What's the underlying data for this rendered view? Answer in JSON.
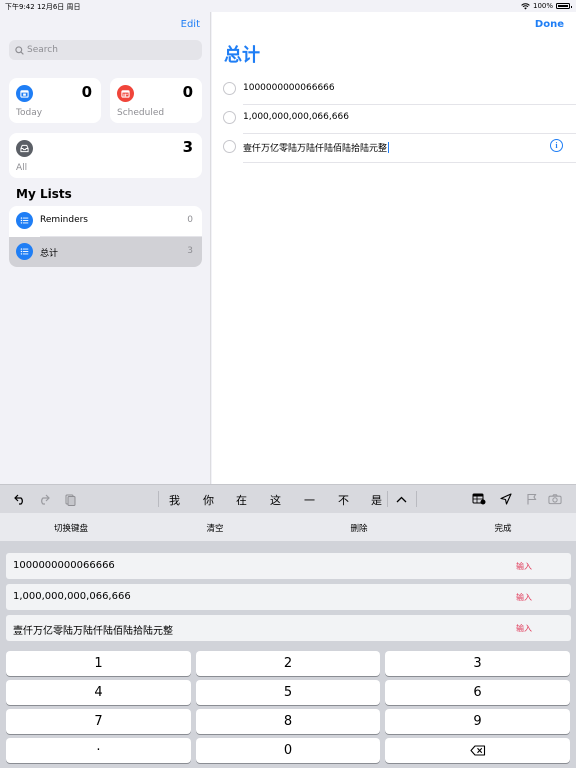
{
  "status_bar": {
    "time_date": "下午9:42  12月6日 周日",
    "battery": "100%"
  },
  "sidebar": {
    "edit_label": "Edit",
    "search_placeholder": "Search",
    "smart_lists": [
      {
        "label": "Today",
        "count": "0",
        "icon": "calendar-today-icon",
        "color": "#1f7ef5"
      },
      {
        "label": "Scheduled",
        "count": "0",
        "icon": "calendar-icon",
        "color": "#f0453a"
      },
      {
        "label": "All",
        "count": "3",
        "icon": "tray-icon",
        "color": "#5b5f66"
      }
    ],
    "my_lists_title": "My Lists",
    "lists": [
      {
        "name": "Reminders",
        "count": "0",
        "icon": "list-icon"
      },
      {
        "name": "总计",
        "count": "3",
        "icon": "list-icon",
        "selected": true
      }
    ]
  },
  "detail": {
    "done_label": "Done",
    "title": "总计",
    "accent": "#1f7ef5",
    "reminders": [
      {
        "text": "1000000000066666"
      },
      {
        "text": "1,000,000,000,066,666"
      },
      {
        "text": "壹仟万亿零陆万陆仟陆佰陆拾陆元整",
        "editing": true
      }
    ]
  },
  "shortcut_bar": {
    "candidates": [
      "我",
      "你",
      "在",
      "这",
      "一",
      "不",
      "是"
    ],
    "icons": [
      "undo-icon",
      "redo-icon",
      "paste-icon",
      "chevron-up-icon",
      "table-icon",
      "location-icon",
      "flag-icon",
      "camera-icon"
    ]
  },
  "keyboard_toolbar": {
    "buttons": [
      "切换键盘",
      "清空",
      "删除",
      "完成"
    ]
  },
  "conversions": {
    "action_label": "输入",
    "action_color": "#e03656",
    "rows": [
      "1000000000066666",
      "1,000,000,000,066,666",
      "壹仟万亿零陆万陆仟陆佰陆拾陆元整"
    ]
  },
  "keypad": {
    "keys": [
      "1",
      "2",
      "3",
      "4",
      "5",
      "6",
      "7",
      "8",
      "9",
      "·",
      "0",
      "delete-icon"
    ]
  }
}
